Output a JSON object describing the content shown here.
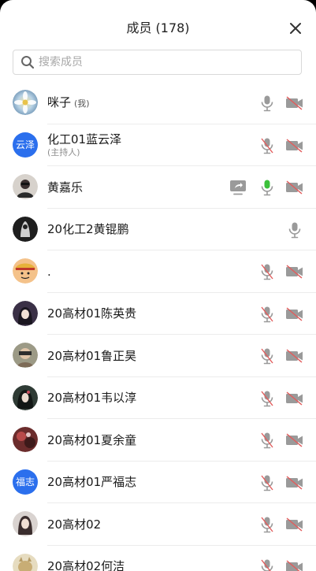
{
  "header": {
    "title": "成员 (178)"
  },
  "search": {
    "placeholder": "搜索成员"
  },
  "colors": {
    "accent_blue": "#2b6fed",
    "muted_red": "#e25c5c",
    "speaking_green": "#3cc13b",
    "icon_gray": "#9a9a9a"
  },
  "members": [
    {
      "name": "咪子",
      "tag": "(我)",
      "sub": "",
      "avatar": "flower-photo",
      "mic": "on",
      "cam": "off",
      "share": false
    },
    {
      "name": "化工01蓝云泽",
      "tag": "",
      "sub": "(主持人)",
      "avatar_text": "云泽",
      "mic": "muted",
      "cam": "off",
      "share": false
    },
    {
      "name": "黄嘉乐",
      "tag": "",
      "sub": "",
      "avatar": "person-photo",
      "mic": "speaking",
      "cam": "off",
      "share": true
    },
    {
      "name": "20化工2黄锟鹏",
      "tag": "",
      "sub": "",
      "avatar": "dark-photo",
      "mic": "on-solo",
      "cam": "none",
      "share": false
    },
    {
      "name": ".",
      "tag": "",
      "sub": "",
      "avatar": "cartoon-photo",
      "mic": "muted",
      "cam": "off",
      "share": false
    },
    {
      "name": "20高材01陈英贵",
      "tag": "",
      "sub": "",
      "avatar": "anime-photo",
      "mic": "muted",
      "cam": "off",
      "share": false
    },
    {
      "name": "20高材01鲁正昊",
      "tag": "",
      "sub": "",
      "avatar": "person-photo-2",
      "mic": "muted",
      "cam": "off",
      "share": false
    },
    {
      "name": "20高材01韦以淳",
      "tag": "",
      "sub": "",
      "avatar": "anime-photo-2",
      "mic": "muted",
      "cam": "off",
      "share": false
    },
    {
      "name": "20高材01夏余童",
      "tag": "",
      "sub": "",
      "avatar": "red-photo",
      "mic": "muted",
      "cam": "off",
      "share": false
    },
    {
      "name": "20高材01严福志",
      "tag": "",
      "sub": "",
      "avatar_text": "福志",
      "mic": "muted",
      "cam": "off",
      "share": false
    },
    {
      "name": "20高材02",
      "tag": "",
      "sub": "",
      "avatar": "girl-photo",
      "mic": "muted",
      "cam": "off",
      "share": false
    },
    {
      "name": "20高材02何洁",
      "tag": "",
      "sub": "",
      "avatar": "cat-photo",
      "mic": "muted",
      "cam": "off",
      "share": false
    }
  ]
}
